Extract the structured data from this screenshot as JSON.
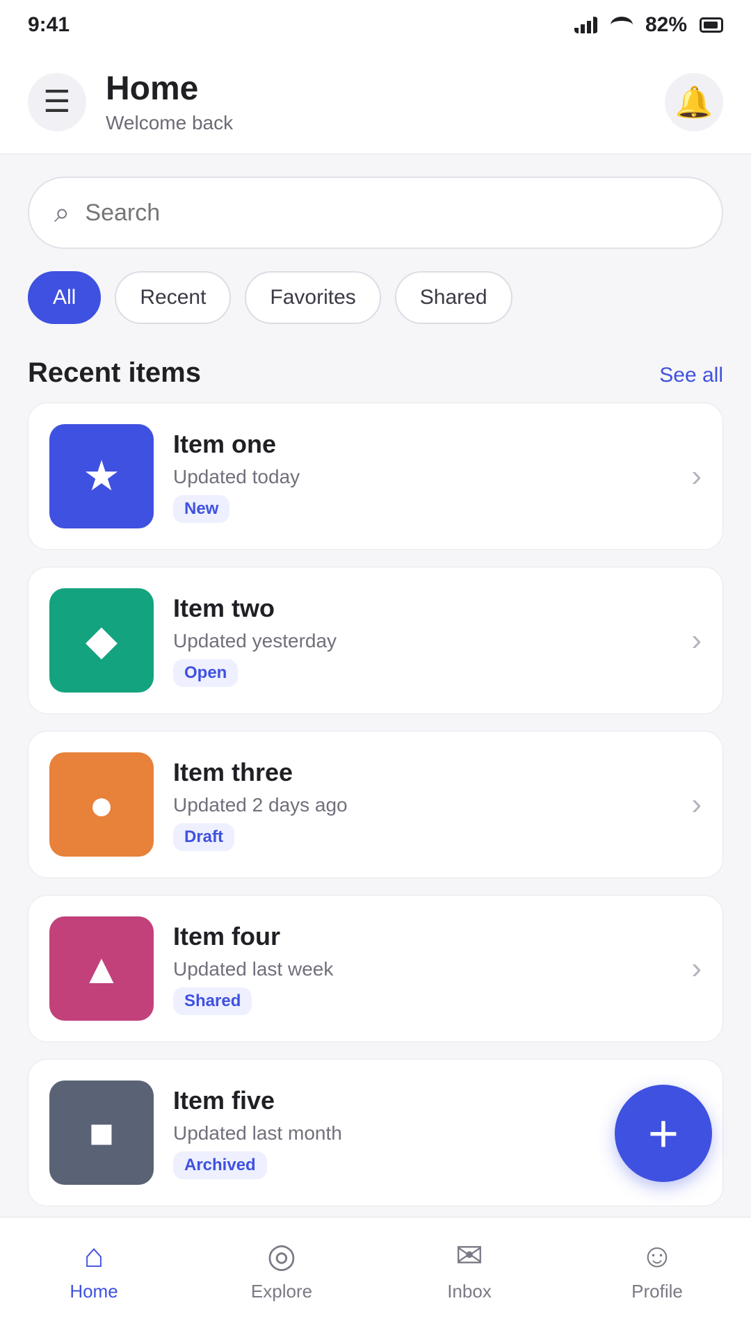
{
  "status": {
    "time": "9:41",
    "battery": "82%"
  },
  "header": {
    "title": "Home",
    "subtitle": "Welcome back",
    "menu_glyph": "☰",
    "bell_glyph": "🔔"
  },
  "search": {
    "placeholder": "Search",
    "glyph": "⌕"
  },
  "chips": [
    {
      "label": "All",
      "active": true
    },
    {
      "label": "Recent",
      "active": false
    },
    {
      "label": "Favorites",
      "active": false
    },
    {
      "label": "Shared",
      "active": false
    }
  ],
  "section": {
    "title": "Recent items",
    "link": "See all"
  },
  "items": [
    {
      "title": "Item one",
      "meta": "Updated today",
      "badge": "New",
      "glyph": "★",
      "color": "#3f51e0"
    },
    {
      "title": "Item two",
      "meta": "Updated yesterday",
      "badge": "Open",
      "glyph": "◆",
      "color": "#14a37f"
    },
    {
      "title": "Item three",
      "meta": "Updated 2 days ago",
      "badge": "Draft",
      "glyph": "●",
      "color": "#e8813a"
    },
    {
      "title": "Item four",
      "meta": "Updated last week",
      "badge": "Shared",
      "glyph": "▲",
      "color": "#c2417a"
    },
    {
      "title": "Item five",
      "meta": "Updated last month",
      "badge": "Archived",
      "glyph": "■",
      "color": "#5a6275"
    }
  ],
  "fab": {
    "glyph": "+"
  },
  "nav": [
    {
      "label": "Home",
      "glyph": "⌂",
      "active": true
    },
    {
      "label": "Explore",
      "glyph": "◎",
      "active": false
    },
    {
      "label": "Inbox",
      "glyph": "✉",
      "active": false
    },
    {
      "label": "Profile",
      "glyph": "☺",
      "active": false
    }
  ]
}
